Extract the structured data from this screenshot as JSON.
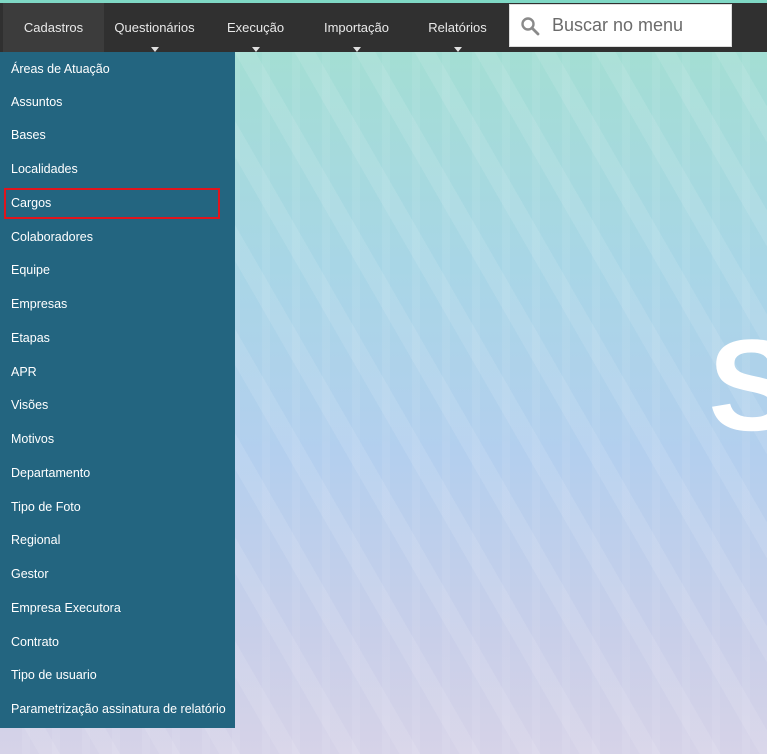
{
  "nav": {
    "items": [
      {
        "label": "Cadastros",
        "active": true,
        "has_caret": false
      },
      {
        "label": "Questionários",
        "active": false,
        "has_caret": true
      },
      {
        "label": "Execução",
        "active": false,
        "has_caret": true
      },
      {
        "label": "Importação",
        "active": false,
        "has_caret": true
      },
      {
        "label": "Relatórios",
        "active": false,
        "has_caret": true
      }
    ],
    "search": {
      "placeholder": "Buscar no menu",
      "icon": "search-icon"
    }
  },
  "menu": {
    "items": [
      "Áreas de Atuação",
      "Assuntos",
      "Bases",
      "Localidades",
      "Cargos",
      "Colaboradores",
      "Equipe",
      "Empresas",
      "Etapas",
      "APR",
      "Visões",
      "Motivos",
      "Departamento",
      "Tipo de Foto",
      "Regional",
      "Gestor",
      "Empresa Executora",
      "Contrato",
      "Tipo de usuario",
      "Parametrização assinatura de relatório"
    ],
    "highlighted_item": "Cargos"
  },
  "colors": {
    "topbar": "#303030",
    "dropdown": "#236580",
    "highlight": "#e0151d"
  }
}
